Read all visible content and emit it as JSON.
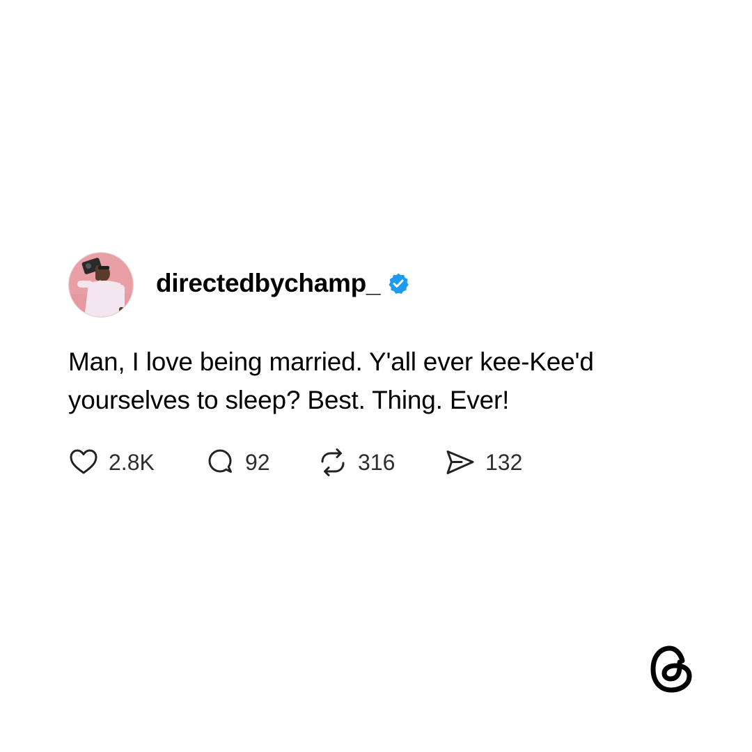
{
  "post": {
    "username": "directedbychamp_",
    "verified": true,
    "avatar_icon": "profile-photo",
    "text": "Man, I love being married. Y'all ever kee-Kee'd yourselves to sleep? Best. Thing. Ever!",
    "actions": {
      "like": {
        "icon": "heart-icon",
        "count": "2.8K"
      },
      "reply": {
        "icon": "comment-bubble-icon",
        "count": "92"
      },
      "repost": {
        "icon": "repost-icon",
        "count": "316"
      },
      "share": {
        "icon": "send-icon",
        "count": "132"
      }
    }
  },
  "brand": {
    "logo": "threads-logo",
    "verified_color": "#1d9bf0",
    "avatar_bg": "#e89aa1"
  }
}
